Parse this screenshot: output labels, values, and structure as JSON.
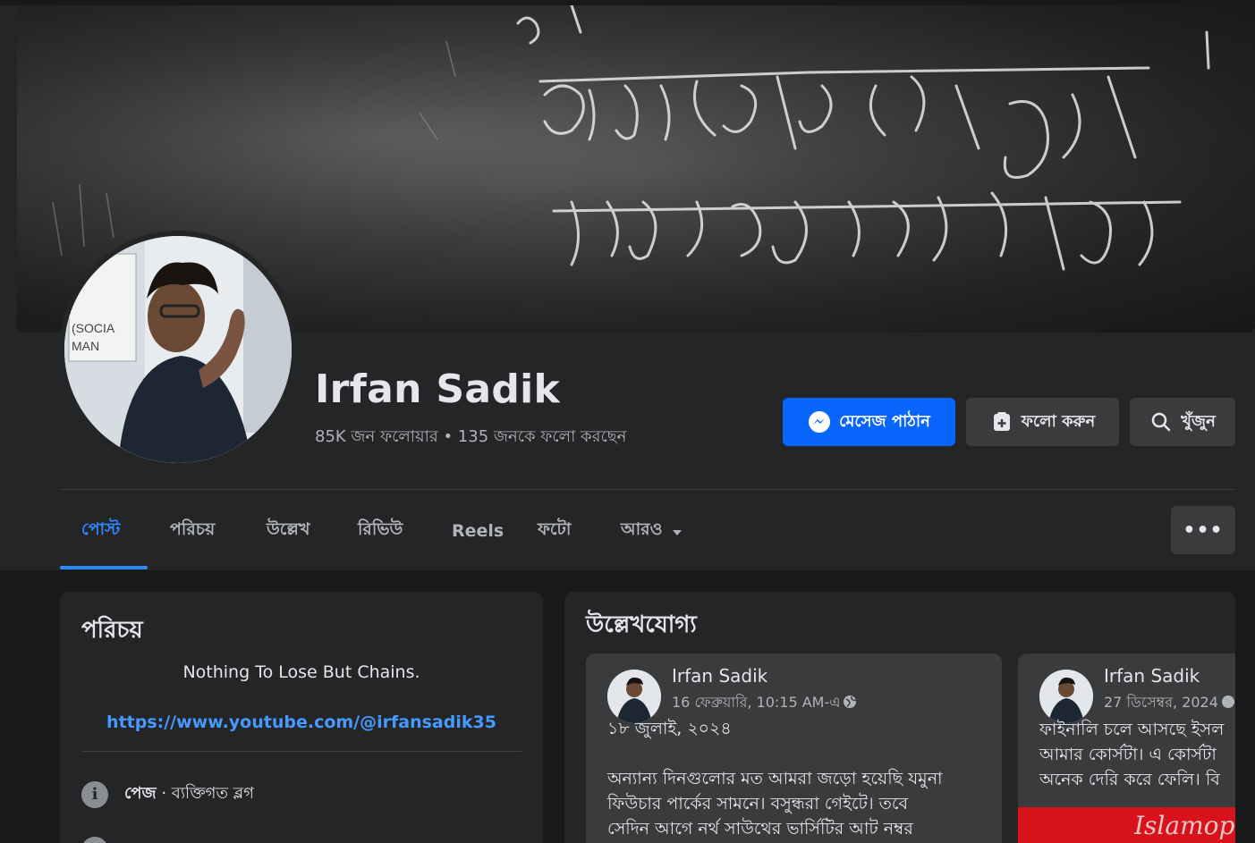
{
  "profile": {
    "name": "Irfan Sadik",
    "followers_line": "85K জন ফলোয়ার • 135 জনকে ফলো করছেন"
  },
  "actions": {
    "message_label": "মেসেজ পাঠান",
    "follow_label": "ফলো করুন",
    "search_label": "খুঁজুন"
  },
  "tabs": [
    {
      "label": "পোস্ট",
      "active": true
    },
    {
      "label": "পরিচয়",
      "active": false
    },
    {
      "label": "উল্লেখ",
      "active": false
    },
    {
      "label": "রিভিউ",
      "active": false
    },
    {
      "label": "Reels",
      "active": false
    },
    {
      "label": "ফটো",
      "active": false
    },
    {
      "label": "আরও",
      "active": false
    }
  ],
  "more_menu_label": "•••",
  "intro": {
    "title": "পরিচয়",
    "bio": "Nothing To Lose But Chains.",
    "link": "https://www.youtube.com/@irfansadik35",
    "category_bold": "পেজ",
    "category_rest": " · ব্যক্তিগত ব্লগ"
  },
  "featured": {
    "title": "উল্লেখযোগ্য",
    "posts": [
      {
        "author": "Irfan Sadik",
        "time": "16 ফেব্রুয়ারি, 10:15 AM-এ",
        "lines": [
          "১৮ জুলাই, ২০২৪",
          "",
          "অন্যান্য দিনগুলোর মত আমরা জড়ো হয়েছি যমুনা",
          "ফিউচার পার্কের সামনে। বসুন্ধরা গেইটে। তবে",
          "সেদিন আগে নর্থ সাউথের ভার্সিটির আট নম্বর"
        ]
      },
      {
        "author": "Irfan Sadik",
        "time": "27 ডিসেম্বর, 2024",
        "lines": [
          "ফাইনালি চলে আসছে ইসল",
          "আমার কোর্সটা। এ কোর্সটা",
          "অনেক দেরি করে ফেলি। বি"
        ],
        "image_caption": "Islamop"
      }
    ]
  },
  "colors": {
    "accent": "#2d88ff",
    "primary_button": "#0866ff",
    "card": "#242526",
    "background": "#18191a"
  }
}
